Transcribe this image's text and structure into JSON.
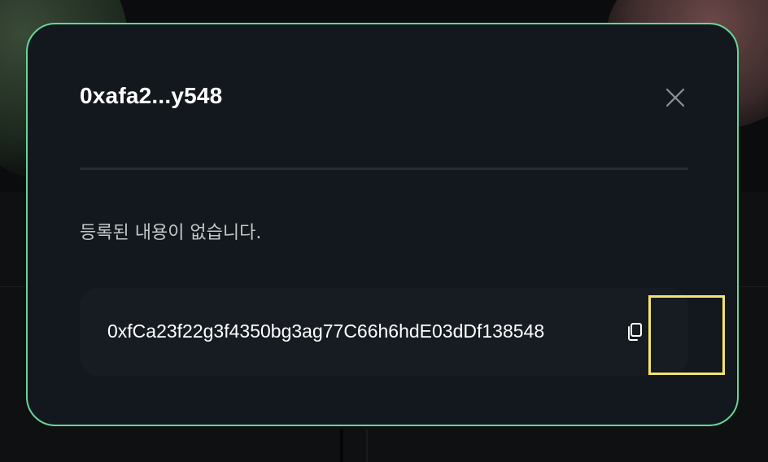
{
  "modal": {
    "title": "0xafa2...y548",
    "empty_message": "등록된 내용이 없습니다.",
    "address": "0xfCa23f22g3f4350bg3ag77C66h6hdE03dDf138548",
    "close_icon": "close-icon",
    "copy_icon": "copy-icon",
    "accent_border_color": "#67d49a",
    "highlight_color": "#f4e46b"
  }
}
